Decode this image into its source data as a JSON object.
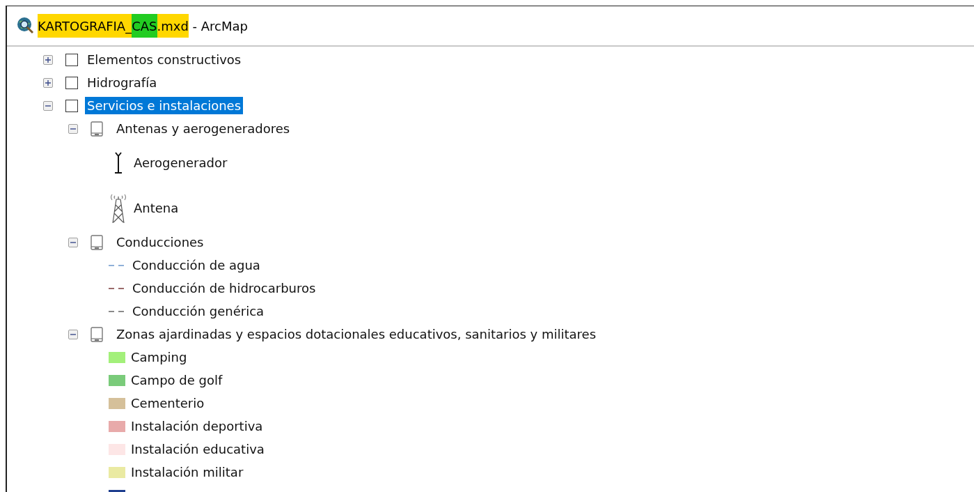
{
  "window": {
    "title": [
      {
        "text": "KARTOGRAFIA_",
        "color": "#ffd700"
      },
      {
        "text": "CAS",
        "color": "#22cc22"
      },
      {
        "text": ".mxd",
        "color": "#ffd700"
      },
      {
        "text": " - ArcMap"
      }
    ]
  },
  "tree": [
    {
      "label": "Elementos constructivos",
      "expanded": false,
      "checked": false,
      "selected": false
    },
    {
      "label": "Hidrografía",
      "expanded": false,
      "checked": false,
      "selected": false
    },
    {
      "label": "Servicios e instalaciones",
      "expanded": true,
      "checked": false,
      "selected": true,
      "children": [
        {
          "label": "Antenas y aerogeneradores",
          "expanded": true,
          "legend": [
            {
              "kind": "turbine",
              "label": "Aerogenerador"
            },
            {
              "kind": "antenna",
              "label": "Antena"
            }
          ]
        },
        {
          "label": "Conducciones",
          "expanded": true,
          "legend": [
            {
              "kind": "line",
              "label": "Conducción de agua",
              "color": "#8fb0d8"
            },
            {
              "kind": "line",
              "label": "Conducción de hidrocarburos",
              "color": "#9a6a6a"
            },
            {
              "kind": "line",
              "label": "Conducción genérica",
              "color": "#8a8a8a"
            }
          ]
        },
        {
          "label": "Zonas ajardinadas y espacios dotacionales educativos, sanitarios y militares",
          "expanded": true,
          "legend": [
            {
              "kind": "fill",
              "label": "Camping",
              "color": "#a3f07a"
            },
            {
              "kind": "fill",
              "label": "Campo de golf",
              "color": "#7acb7a"
            },
            {
              "kind": "fill",
              "label": "Cementerio",
              "color": "#d5c09a"
            },
            {
              "kind": "fill",
              "label": "Instalación deportiva",
              "color": "#e8aaaa"
            },
            {
              "kind": "fill",
              "label": "Instalación educativa",
              "color": "#fde6e6"
            },
            {
              "kind": "fill",
              "label": "Instalación militar",
              "color": "#eaeaa2"
            },
            {
              "kind": "fill",
              "color": "#1f3f8f"
            }
          ]
        }
      ]
    }
  ]
}
